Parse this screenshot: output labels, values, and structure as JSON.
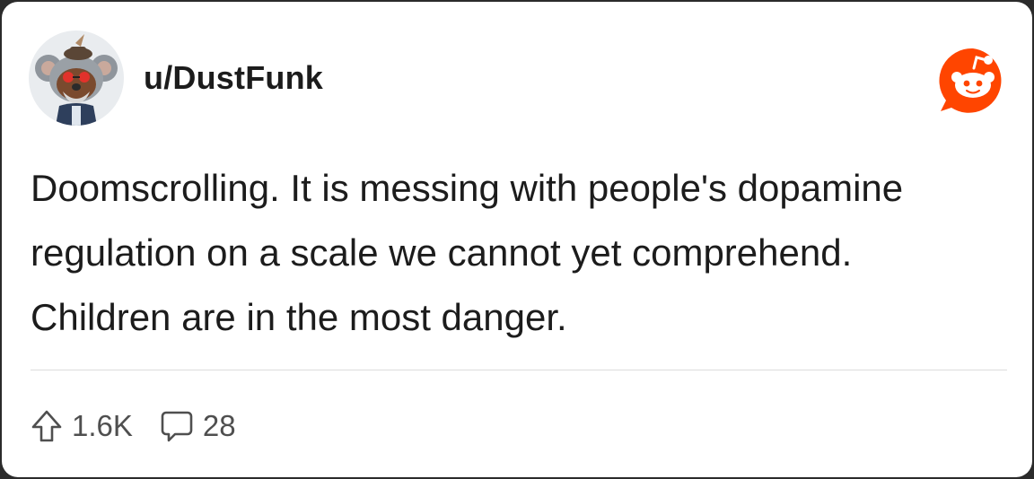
{
  "post": {
    "username": "u/DustFunk",
    "body_lines": [
      "Doomscrolling. It is messing with people's dopamine",
      "regulation on a scale we cannot yet comprehend.",
      "Children are in the most danger."
    ],
    "upvotes": "1.6K",
    "comments": "28"
  },
  "icons": {
    "avatar": "koala-avatar",
    "logo": "reddit-snoo-icon",
    "upvote": "upvote-arrow-icon",
    "comment": "comment-bubble-icon"
  },
  "colors": {
    "reddit_orange": "#FF4500",
    "text": "#1c1c1c",
    "meta_text": "#4f4f4f",
    "divider": "#dcdcdc"
  }
}
